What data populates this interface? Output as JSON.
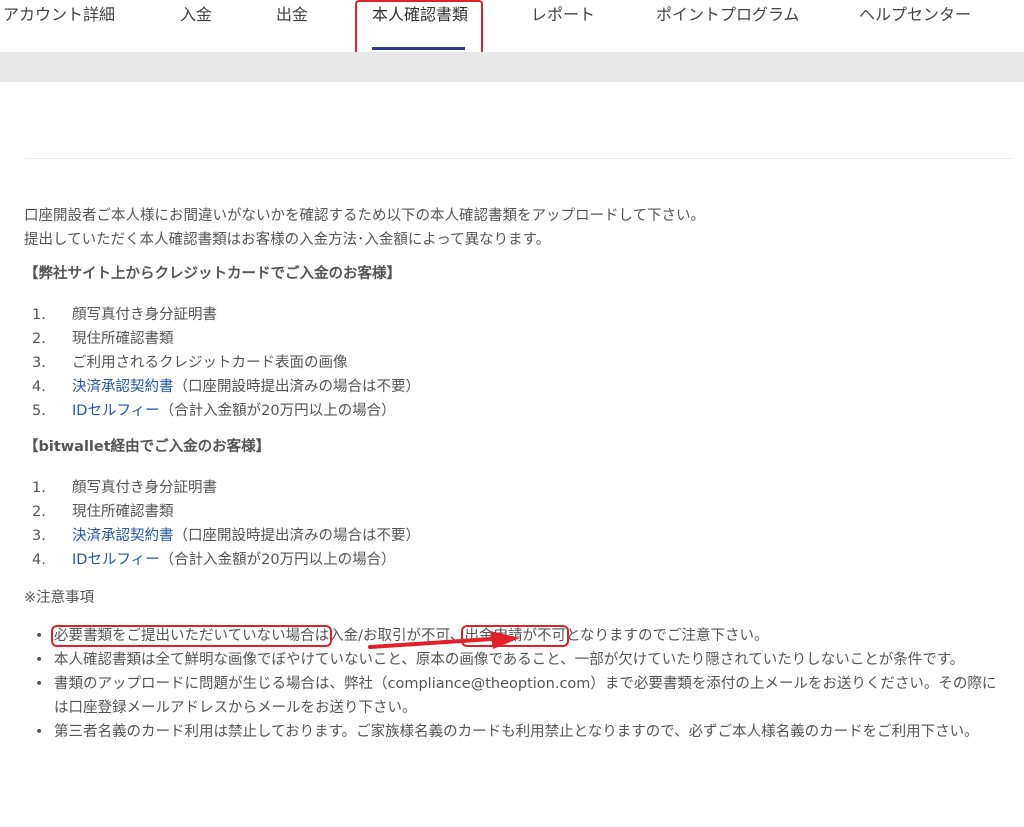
{
  "nav": {
    "items": [
      {
        "label": "アカウント詳細"
      },
      {
        "label": "入金"
      },
      {
        "label": "出金"
      },
      {
        "label": "本人確認書類"
      },
      {
        "label": "レポート"
      },
      {
        "label": "ポイントプログラム"
      },
      {
        "label": "ヘルプセンター"
      }
    ],
    "active_index": 3
  },
  "intro": {
    "line1": "口座開設者ご本人様にお間違いがないかを確認するため以下の本人確認書類をアップロードして下さい。",
    "line2": "提出していただく本人確認書類はお客様の入金方法･入金額によって異なります。"
  },
  "sections": [
    {
      "title": "【弊社サイト上からクレジットカードでご入金のお客様】",
      "items": [
        {
          "num": "1.",
          "text": "顔写真付き身分証明書",
          "link": "",
          "suffix": ""
        },
        {
          "num": "2.",
          "text": "現住所確認書類",
          "link": "",
          "suffix": ""
        },
        {
          "num": "3.",
          "text": "ご利用されるクレジットカード表面の画像",
          "link": "",
          "suffix": ""
        },
        {
          "num": "4.",
          "text": "",
          "link": "決済承認契約書",
          "suffix": "（口座開設時提出済みの場合は不要）"
        },
        {
          "num": "5.",
          "text": "",
          "link": "IDセルフィー",
          "suffix": "（合計入金額が20万円以上の場合）"
        }
      ]
    },
    {
      "title": "【bitwallet経由でご入金のお客様】",
      "items": [
        {
          "num": "1.",
          "text": "顔写真付き身分証明書",
          "link": "",
          "suffix": ""
        },
        {
          "num": "2.",
          "text": "現住所確認書類",
          "link": "",
          "suffix": ""
        },
        {
          "num": "3.",
          "text": "",
          "link": "決済承認契約書",
          "suffix": "（口座開設時提出済みの場合は不要）"
        },
        {
          "num": "4.",
          "text": "",
          "link": "IDセルフィー",
          "suffix": "（合計入金額が20万円以上の場合）"
        }
      ]
    }
  ],
  "notes": {
    "heading": "※注意事項",
    "bullet": "•",
    "note1": {
      "part_a": "必要書類をご提出いただいていない場合は",
      "part_b": "入金/お取引が不可、",
      "part_c": "出金申請が不可",
      "part_d": "となりますのでご注意下さい。"
    },
    "note2": "本人確認書類は全て鮮明な画像でぼやけていないこと、原本の画像であること、一部が欠けていたり隠されていたりしないことが条件です。",
    "note3": "書類のアップロードに問題が生じる場合は、弊社（compliance@theoption.com）まで必要書類を添付の上メールをお送りください。その際には口座登録メールアドレスからメールをお送り下さい。",
    "note4": "第三者名義のカード利用は禁止しております。ご家族様名義のカードも利用禁止となりますので、必ずご本人様名義のカードをご利用下さい。"
  },
  "colors": {
    "accent_underline": "#2f3a8f",
    "highlight_red": "#e0202a",
    "link_blue": "#2557a7"
  }
}
